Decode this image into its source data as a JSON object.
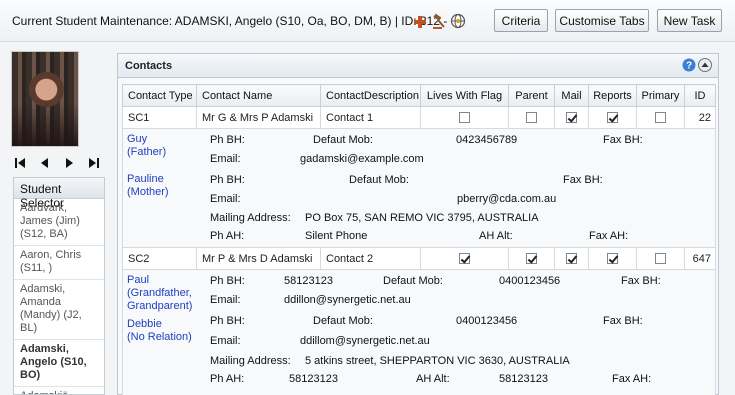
{
  "header": {
    "title": "Current Student Maintenance: ADAMSKI, Angelo (S10, Oa, BO, DM, B) | ID: 312 -",
    "icons": [
      "add-icon",
      "gavel-icon",
      "globe-icon"
    ],
    "buttons": {
      "criteria": "Criteria",
      "customise_tabs": "Customise Tabs",
      "new_task": "New Task"
    }
  },
  "photo_nav": [
    "first",
    "prev",
    "next",
    "last"
  ],
  "selector": {
    "title": "Student Selector",
    "students": [
      {
        "name": "Aardvark, James (Jim) (S12, BA)",
        "active": false
      },
      {
        "name": "Aaron, Chris (S11, )",
        "active": false
      },
      {
        "name": "Adamski, Amanda (Mandy) (J2, BL)",
        "active": false
      },
      {
        "name": "Adamski, Angelo (S10, BO)",
        "active": true
      },
      {
        "name": "Adamskië,",
        "active": false
      }
    ]
  },
  "panel": {
    "title": "Contacts",
    "columns": [
      "Contact Type",
      "Contact Name",
      "ContactDescription",
      "Lives With Flag",
      "Parent",
      "Mail",
      "Reports",
      "Primary",
      "ID"
    ],
    "rows": [
      {
        "type": "SC1",
        "name": "Mr G & Mrs P Adamski",
        "description": "Contact 1",
        "lives_with": false,
        "parent": false,
        "mail": true,
        "reports": true,
        "primary": false,
        "id": "22",
        "persons": [
          {
            "name": "Guy",
            "relation": "(Father)",
            "ph_bh_label": "Ph BH:",
            "ph_bh": "",
            "mob_label": "Defaut Mob:",
            "mob": "0423456789",
            "fax_label": "Fax BH:",
            "fax": "",
            "email_label": "Email:",
            "email": "gadamski@example.com"
          },
          {
            "name": "Pauline",
            "relation": "(Mother)",
            "ph_bh_label": "Ph BH:",
            "ph_bh": "",
            "mob_label": "Defaut Mob:",
            "mob": "",
            "fax_label": "Fax BH:",
            "fax": "",
            "email_label": "Email:",
            "email": "pberry@cda.com.au"
          }
        ],
        "mailing": {
          "address_label": "Mailing Address:",
          "address": "PO Box 75, SAN REMO VIC 3795, AUSTRALIA",
          "ph_ah_label": "Ph AH:",
          "ph_ah": "Silent Phone",
          "ah_alt_label": "AH Alt:",
          "ah_alt": "",
          "fax_ah_label": "Fax AH:",
          "fax_ah": ""
        }
      },
      {
        "type": "SC2",
        "name": "Mr P & Mrs D Adamski",
        "description": "Contact 2",
        "lives_with": true,
        "parent": true,
        "mail": true,
        "reports": true,
        "primary": false,
        "id": "647",
        "persons": [
          {
            "name": "Paul",
            "relation": "(Grandfather, Grandparent)",
            "ph_bh_label": "Ph BH:",
            "ph_bh": "58123123",
            "mob_label": "Defaut Mob:",
            "mob": "0400123456",
            "fax_label": "Fax BH:",
            "fax": "",
            "email_label": "Email:",
            "email": "ddillon@synergetic.net.au"
          },
          {
            "name": "Debbie",
            "relation": "(No Relation)",
            "ph_bh_label": "Ph BH:",
            "ph_bh": "",
            "mob_label": "Defaut Mob:",
            "mob": "0400123456",
            "fax_label": "Fax BH:",
            "fax": "",
            "email_label": "Email:",
            "email": "ddillom@synergetic.net.au"
          }
        ],
        "mailing": {
          "address_label": "Mailing Address:",
          "address": "5 atkins street, SHEPPARTON VIC 3630, AUSTRALIA",
          "ph_ah_label": "Ph AH:",
          "ph_ah": "58123123",
          "ah_alt_label": "AH Alt:",
          "ah_alt": "58123123",
          "fax_ah_label": "Fax AH:",
          "fax_ah": ""
        }
      }
    ]
  }
}
